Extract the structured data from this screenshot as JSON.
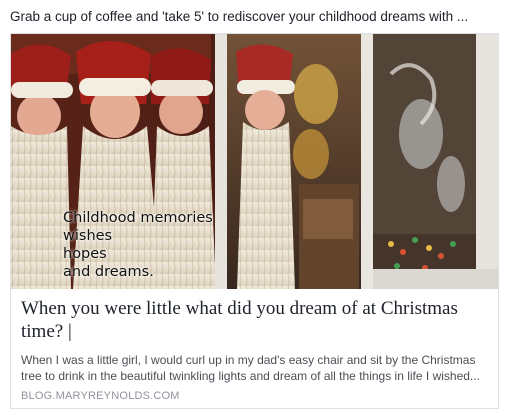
{
  "post": {
    "text": "Grab a cup of coffee and 'take 5' to rediscover your childhood dreams with ..."
  },
  "link_card": {
    "image_caption": {
      "line1": "Childhood memories",
      "line2": "wishes",
      "line3": "hopes",
      "line4": "and dreams."
    },
    "title": "When you were little what did you dream of at Christmas time? |",
    "description": "When I was a little girl, I would curl up in my dad's easy chair and sit by the Christmas tree to drink in the beautiful twinkling lights and dream of all the things in life I wished...",
    "domain": "BLOG.MARYREYNOLDS.COM"
  }
}
